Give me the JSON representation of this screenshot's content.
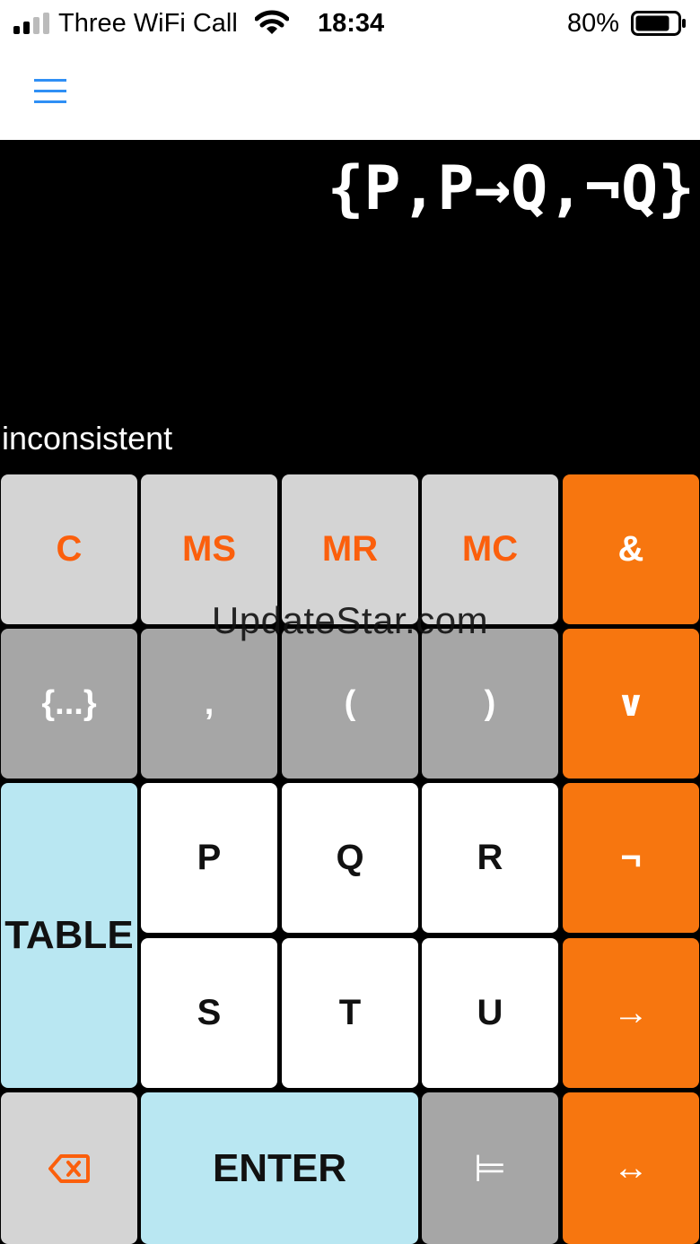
{
  "status_bar": {
    "carrier": "Three WiFi Call",
    "time": "18:34",
    "battery_percent": "80%",
    "battery_level": 0.8,
    "signal_bars": 4,
    "signal_active_bars": 2
  },
  "nav": {
    "menu_icon": "hamburger-menu-icon",
    "accent": "#2f8ff5"
  },
  "display": {
    "expression": "{P,P→Q,¬Q}",
    "result": "inconsistent"
  },
  "keys": {
    "c": "C",
    "ms": "MS",
    "mr": "MR",
    "mc": "MC",
    "and": "&",
    "set": "{...}",
    "comma": ",",
    "lparen": "(",
    "rparen": ")",
    "or": "∨",
    "table": "TABLE",
    "p": "P",
    "q": "Q",
    "r": "R",
    "not": "¬",
    "s": "S",
    "t": "T",
    "u": "U",
    "implies": "→",
    "backspace_icon": "backspace-icon",
    "enter": "ENTER",
    "entails": "⊨",
    "iff": "↔"
  },
  "watermark": "UpdateStar.com",
  "colors": {
    "orange_key": "#f7760f",
    "orange_text": "#fb5f0c",
    "light_gray_key": "#d4d4d4",
    "dark_gray_key": "#a6a6a6",
    "blue_key": "#b9e7f2",
    "white_key": "#ffffff"
  }
}
